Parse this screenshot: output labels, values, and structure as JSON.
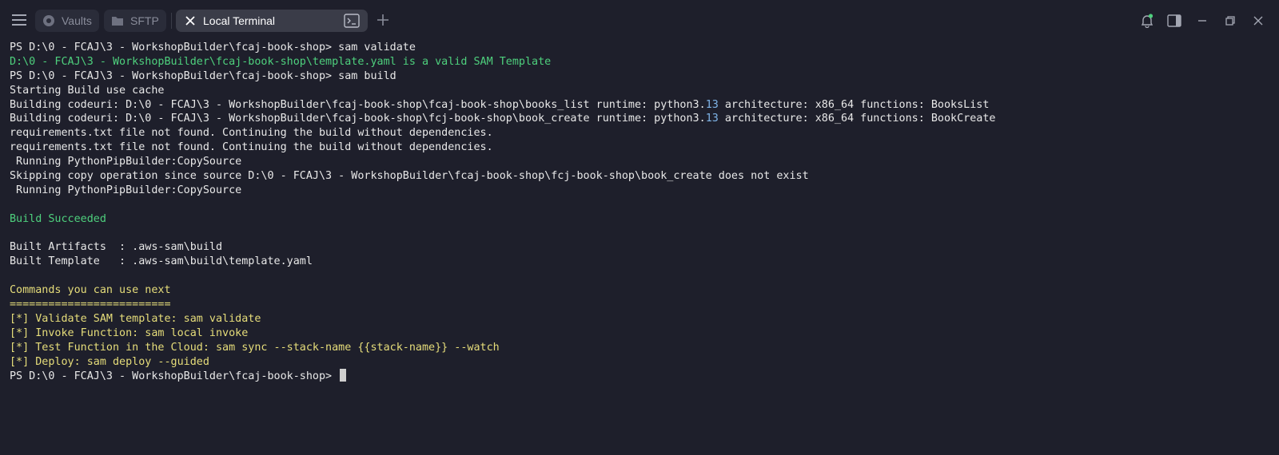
{
  "tabs": [
    {
      "label": "Vaults",
      "icon": "vault-icon"
    },
    {
      "label": "SFTP",
      "icon": "folder-icon"
    },
    {
      "label": "Local Terminal",
      "icon": "close-icon",
      "active": true
    }
  ],
  "colors": {
    "background": "#1e1f2b",
    "tab_inactive": "#2a2c39",
    "tab_active": "#3a3c48",
    "green": "#4ed07d",
    "yellow": "#e6dd7a",
    "number": "#7fb5e8",
    "bell_green": "#4ed07d"
  },
  "terminal": {
    "lines": [
      [
        {
          "t": "PS D:\\0 - FCAJ\\3 - WorkshopBuilder\\fcaj-book-shop> sam validate",
          "c": "white"
        }
      ],
      [
        {
          "t": "D:\\0 - FCAJ\\3 - WorkshopBuilder\\fcaj-book-shop\\template.yaml is a valid SAM Template",
          "c": "green"
        }
      ],
      [
        {
          "t": "PS D:\\0 - FCAJ\\3 - WorkshopBuilder\\fcaj-book-shop> sam build",
          "c": "white"
        }
      ],
      [
        {
          "t": "Starting Build use cache",
          "c": "white"
        }
      ],
      [
        {
          "t": "Building codeuri: D:\\0 - FCAJ\\3 - WorkshopBuilder\\fcaj-book-shop\\fcaj-book-shop\\books_list runtime: python3.",
          "c": "white"
        },
        {
          "t": "13",
          "c": "num"
        },
        {
          "t": " architecture: x86_64 functions: BooksList",
          "c": "white"
        }
      ],
      [
        {
          "t": "Building codeuri: D:\\0 - FCAJ\\3 - WorkshopBuilder\\fcaj-book-shop\\fcj-book-shop\\book_create runtime: python3.",
          "c": "white"
        },
        {
          "t": "13",
          "c": "num"
        },
        {
          "t": " architecture: x86_64 functions: BookCreate",
          "c": "white"
        }
      ],
      [
        {
          "t": "requirements.txt file not found. Continuing the build without dependencies.",
          "c": "white"
        }
      ],
      [
        {
          "t": "requirements.txt file not found. Continuing the build without dependencies.",
          "c": "white"
        }
      ],
      [
        {
          "t": " Running PythonPipBuilder:CopySource",
          "c": "white"
        }
      ],
      [
        {
          "t": "Skipping copy operation since source D:\\0 - FCAJ\\3 - WorkshopBuilder\\fcaj-book-shop\\fcj-book-shop\\book_create does not exist",
          "c": "white"
        }
      ],
      [
        {
          "t": " Running PythonPipBuilder:CopySource",
          "c": "white"
        }
      ],
      [
        {
          "t": "",
          "c": "white"
        }
      ],
      [
        {
          "t": "Build Succeeded",
          "c": "green"
        }
      ],
      [
        {
          "t": "",
          "c": "white"
        }
      ],
      [
        {
          "t": "Built Artifacts  : .aws-sam\\build",
          "c": "white"
        }
      ],
      [
        {
          "t": "Built Template   : .aws-sam\\build\\template.yaml",
          "c": "white"
        }
      ],
      [
        {
          "t": "",
          "c": "white"
        }
      ],
      [
        {
          "t": "Commands you can use next",
          "c": "yellow"
        }
      ],
      [
        {
          "t": "=========================",
          "c": "yellow"
        }
      ],
      [
        {
          "t": "[*] Validate SAM template: sam validate",
          "c": "yellow"
        }
      ],
      [
        {
          "t": "[*] Invoke Function: sam local invoke",
          "c": "yellow"
        }
      ],
      [
        {
          "t": "[*] Test Function in the Cloud: sam sync --stack-name {{stack-name}} --watch",
          "c": "yellow"
        }
      ],
      [
        {
          "t": "[*] Deploy: sam deploy --guided",
          "c": "yellow"
        }
      ],
      [
        {
          "t": "PS D:\\0 - FCAJ\\3 - WorkshopBuilder\\fcaj-book-shop> ",
          "c": "white"
        }
      ]
    ]
  }
}
